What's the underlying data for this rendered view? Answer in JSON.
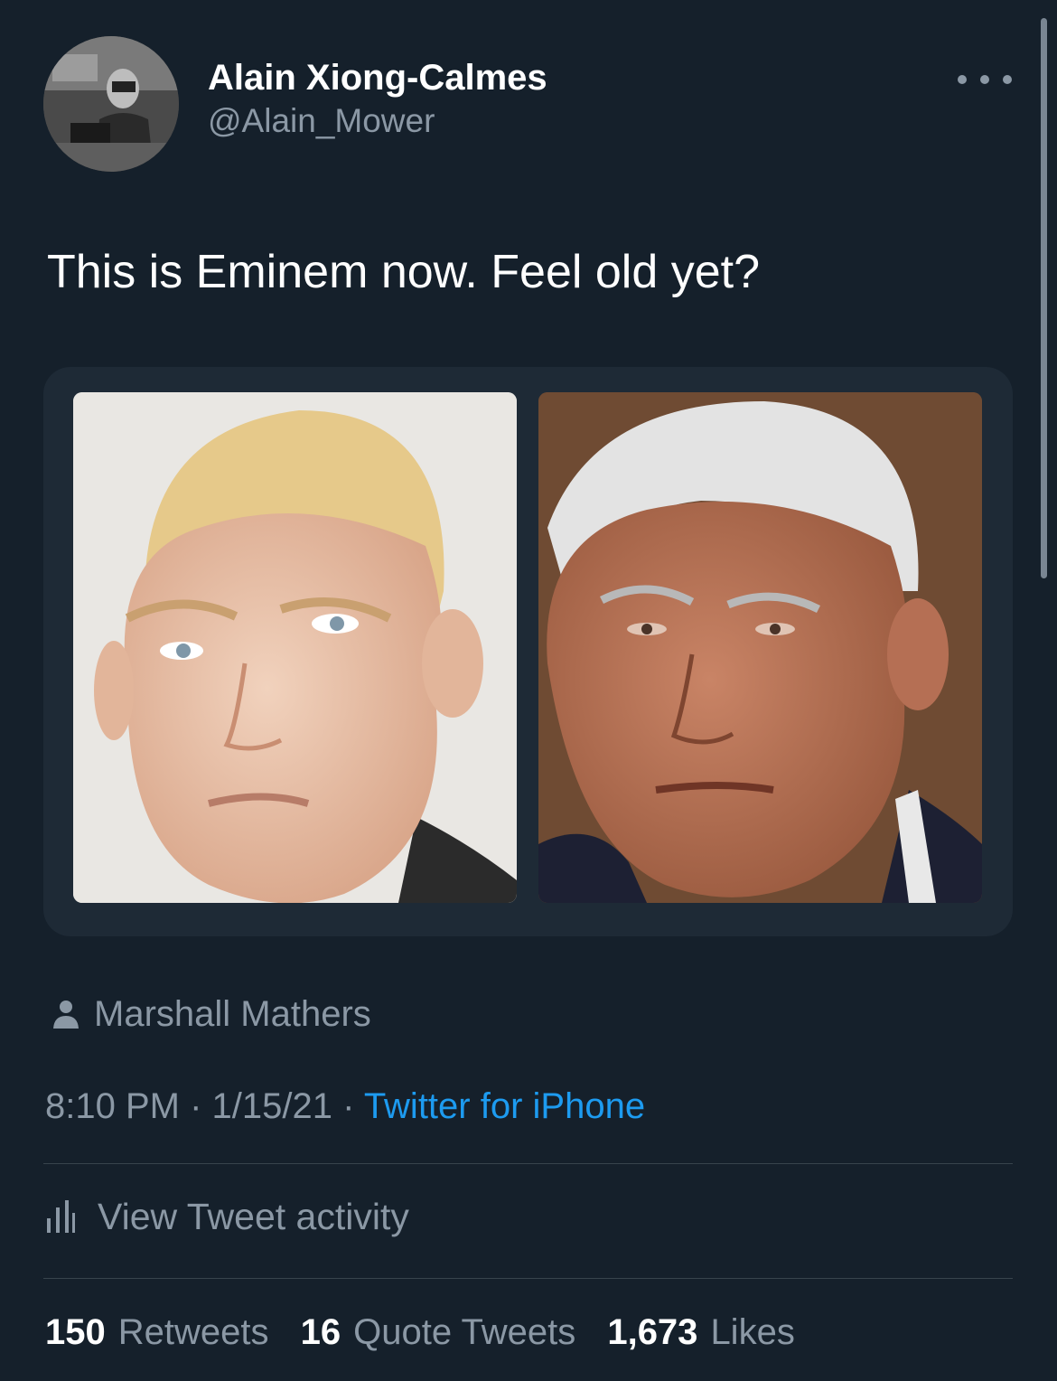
{
  "tweet": {
    "author": {
      "display_name": "Alain Xiong-Calmes",
      "handle": "@Alain_Mower"
    },
    "more_icon": "more-horizontal-icon",
    "text": "This is Eminem now. Feel old yet?",
    "media": {
      "images": [
        {
          "subject": "portrait-photo-young-blond-man"
        },
        {
          "subject": "portrait-photo-older-white-haired-man"
        }
      ]
    },
    "tagged_person": {
      "icon": "person-icon",
      "name": "Marshall Mathers"
    },
    "meta": {
      "time": "8:10 PM",
      "separator": " · ",
      "date": "1/15/21",
      "source": "Twitter for iPhone"
    },
    "activity": {
      "icon": "bar-chart-icon",
      "label": "View Tweet activity"
    },
    "stats": {
      "retweets": {
        "count": "150",
        "label": "Retweets"
      },
      "quote_tweets": {
        "count": "16",
        "label": "Quote Tweets"
      },
      "likes": {
        "count": "1,673",
        "label": "Likes"
      }
    }
  },
  "colors": {
    "background": "#15202b",
    "text_primary": "#ffffff",
    "text_secondary": "#8b98a5",
    "link": "#1d9bf0",
    "divider": "#38444d",
    "media_card": "#1e2a36"
  }
}
